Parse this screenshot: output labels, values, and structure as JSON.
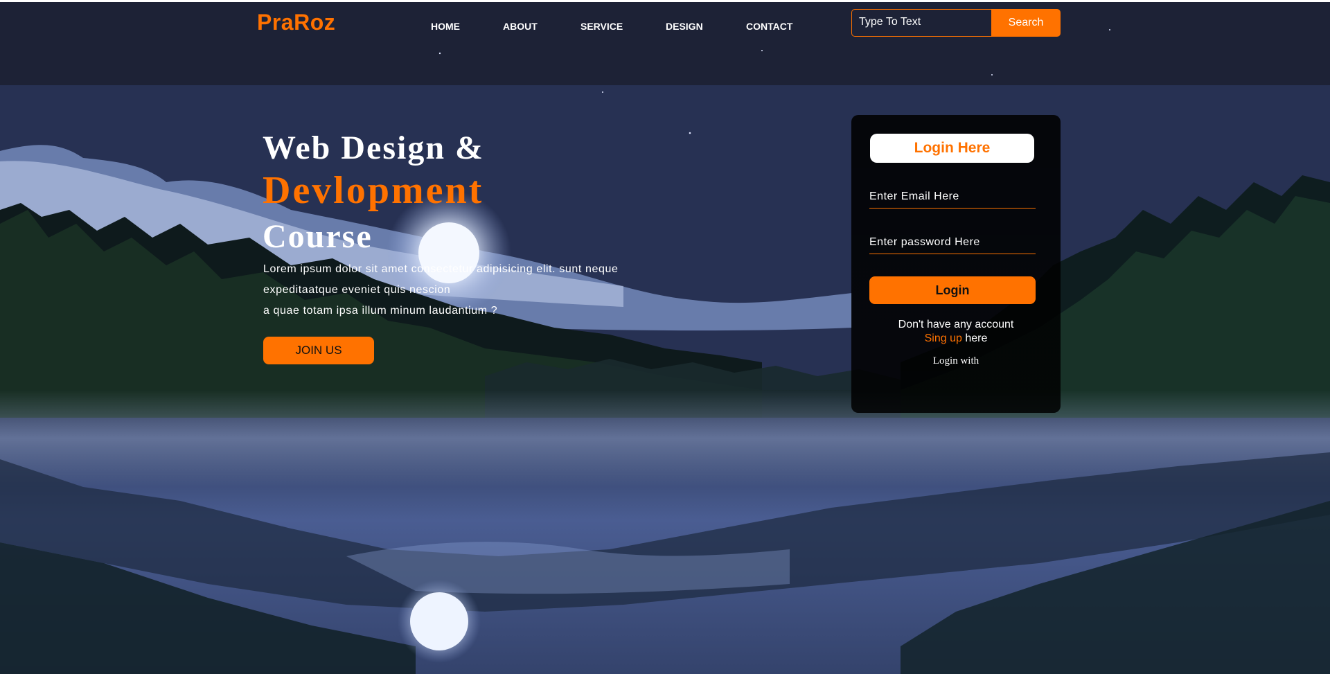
{
  "brand": {
    "logo": "PraRoz",
    "accent_color": "#ff7200"
  },
  "nav": {
    "items": [
      {
        "label": "HOME"
      },
      {
        "label": "ABOUT"
      },
      {
        "label": "SERVICE"
      },
      {
        "label": "DESIGN"
      },
      {
        "label": "CONTACT"
      }
    ]
  },
  "search": {
    "placeholder": "Type To Text",
    "button_label": "Search"
  },
  "hero": {
    "headline_line1": "Web Design &",
    "headline_line2": "Devlopment",
    "headline_line3": "Course",
    "paragraph_lines": [
      "Lorem ipsum dolor sit amet consectetur adipisicing elit. sunt neque",
      "expeditaatque eveniet quis nescion",
      "a quae totam ipsa illum minum laudantium ?"
    ],
    "cta_label": "JOIN US"
  },
  "login": {
    "title": "Login Here",
    "email_placeholder": "Enter Email Here",
    "password_placeholder": "Enter password Here",
    "button_label": "Login",
    "no_account_text": "Don't have any account",
    "signup_link": "Sing up",
    "signup_suffix": "here",
    "login_with": "Login with"
  }
}
